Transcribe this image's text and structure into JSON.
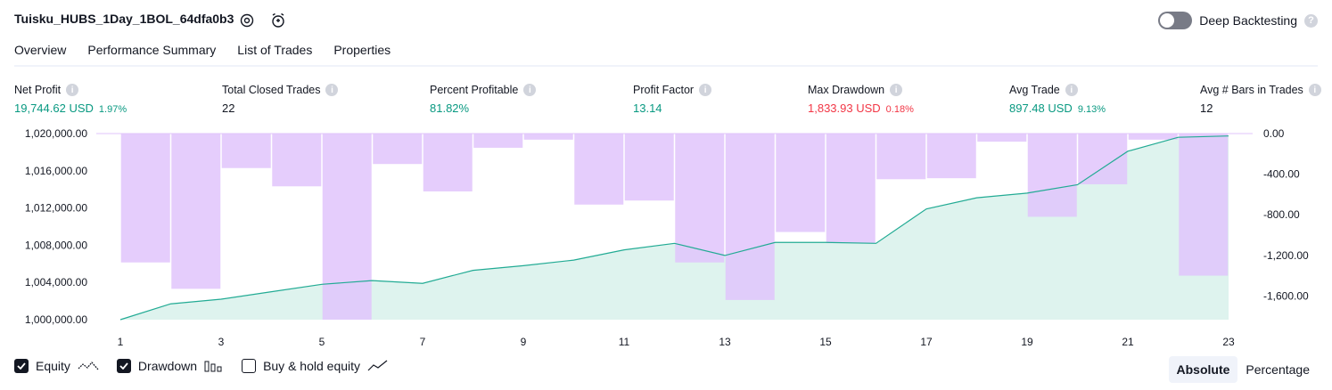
{
  "header": {
    "title": "Tuisku_HUBS_1Day_1BOL_64dfa0b3",
    "deep_backtesting_label": "Deep Backtesting"
  },
  "tabs": [
    "Overview",
    "Performance Summary",
    "List of Trades",
    "Properties"
  ],
  "metrics": [
    {
      "label": "Net Profit",
      "value": "19,744.62 USD",
      "pct": "1.97%",
      "color": "green"
    },
    {
      "label": "Total Closed Trades",
      "value": "22",
      "pct": "",
      "color": "dark"
    },
    {
      "label": "Percent Profitable",
      "value": "81.82%",
      "pct": "",
      "color": "green"
    },
    {
      "label": "Profit Factor",
      "value": "13.14",
      "pct": "",
      "color": "green"
    },
    {
      "label": "Max Drawdown",
      "value": "1,833.93 USD",
      "pct": "0.18%",
      "color": "red"
    },
    {
      "label": "Avg Trade",
      "value": "897.48 USD",
      "pct": "9.13%",
      "color": "green"
    },
    {
      "label": "Avg # Bars in Trades",
      "value": "12",
      "pct": "",
      "color": "dark"
    }
  ],
  "legend": {
    "equity": "Equity",
    "drawdown": "Drawdown",
    "buy_hold": "Buy & hold equity"
  },
  "view_toggle": {
    "absolute": "Absolute",
    "percentage": "Percentage"
  },
  "colors": {
    "equity_line": "#22ab94",
    "equity_fill": "#def3ee",
    "drawdown_bar": "#e1c4fb",
    "positive": "#089981",
    "negative": "#f23645"
  },
  "chart_data": {
    "type": "area",
    "x_ticks": [
      "1",
      "3",
      "5",
      "7",
      "9",
      "11",
      "13",
      "15",
      "17",
      "19",
      "21",
      "23"
    ],
    "left_axis_ticks": [
      "1,020,000.00",
      "1,016,000.00",
      "1,012,000.00",
      "1,008,000.00",
      "1,004,000.00",
      "1,000,000.00"
    ],
    "right_axis_ticks": [
      "0.00",
      "-400.00",
      "-800.00",
      "-1,200.00",
      "-1,600.00"
    ],
    "equity_ylim": [
      1000000,
      1020000
    ],
    "drawdown_ylim": [
      -1833.93,
      0
    ],
    "series": [
      {
        "name": "Equity",
        "x": [
          1,
          2,
          3,
          4,
          5,
          6,
          7,
          8,
          9,
          10,
          11,
          12,
          13,
          14,
          15,
          16,
          17,
          18,
          19,
          20,
          21,
          22,
          23
        ],
        "values": [
          1000000,
          1001700,
          1002200,
          1003000,
          1003800,
          1004200,
          1003900,
          1005300,
          1005800,
          1006400,
          1007500,
          1008200,
          1006900,
          1008300,
          1008300,
          1008200,
          1011900,
          1013100,
          1013600,
          1014500,
          1018100,
          1019600,
          1019744.62
        ]
      },
      {
        "name": "Drawdown",
        "x": [
          2,
          3,
          4,
          5,
          6,
          7,
          8,
          9,
          10,
          11,
          12,
          13,
          14,
          15,
          16,
          17,
          18,
          19,
          20,
          21,
          22,
          23
        ],
        "values": [
          -1270,
          -1530,
          -340,
          -520,
          -1833.93,
          -300,
          -570,
          -140,
          -60,
          -700,
          -660,
          -1270,
          -1640,
          -970,
          -1080,
          -450,
          -440,
          -80,
          -820,
          -500,
          -60,
          -1400
        ]
      }
    ]
  }
}
